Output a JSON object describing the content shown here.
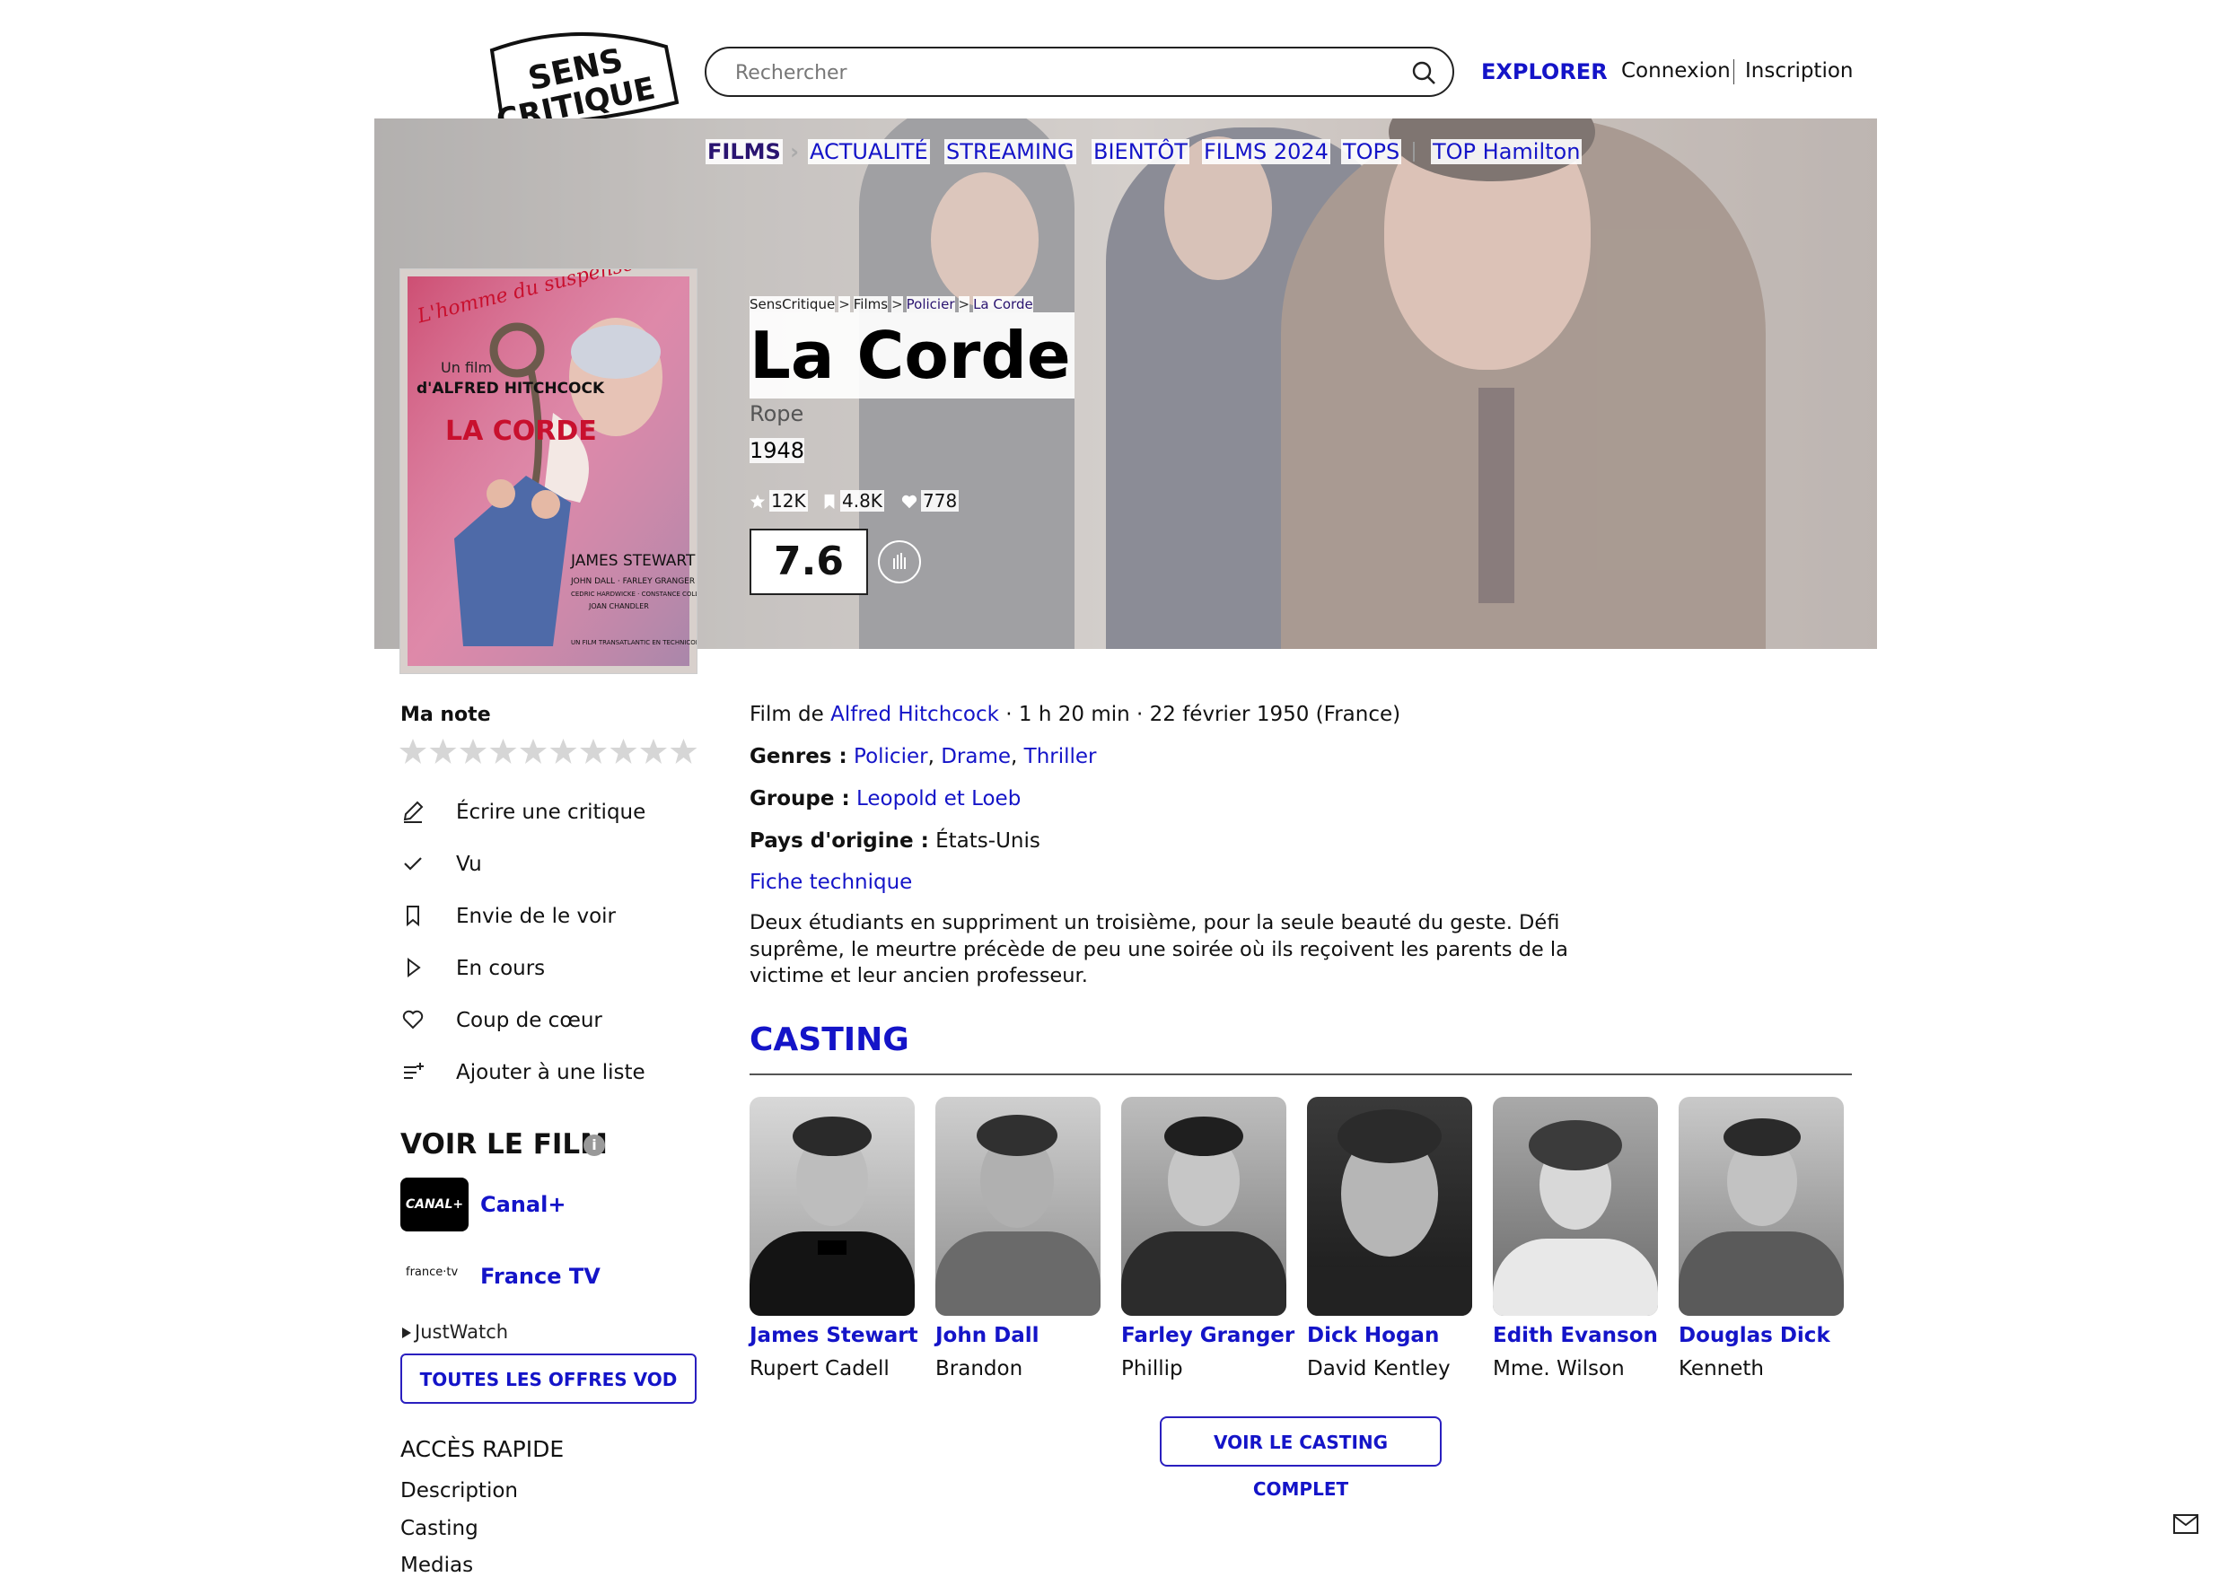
{
  "header": {
    "logo_text": "SENS CRITIQUE",
    "search_placeholder": "Rechercher",
    "explorer": "EXPLORER",
    "connexion": "Connexion",
    "inscription": "Inscription"
  },
  "nav": {
    "films": "FILMS",
    "items": [
      "ACTUALITÉ",
      "STREAMING",
      "BIENTÔT",
      "FILMS 2024",
      "TOPS",
      "TOP Hamilton"
    ]
  },
  "breadcrumb": [
    "SensCritique",
    "Films",
    "Policier",
    "La Corde"
  ],
  "movie": {
    "title": "La Corde",
    "original_title": "Rope",
    "year": "1948",
    "ratings_count": "12K",
    "wishlist_count": "4.8K",
    "favorites_count": "778",
    "score": "7.6",
    "poster_text": {
      "tagline": "L'homme du suspense!",
      "by": "Un film",
      "director": "d'ALFRED HITCHCOCK",
      "title": "LA CORDE",
      "star": "JAMES STEWART",
      "costars": "JOHN DALL · FARLEY GRANGER",
      "costars2": "CEDRIC HARDWICKE · CONSTANCE COLLIER",
      "costars3": "JOAN CHANDLER",
      "format": "UN FILM TRANSATLANTIC EN TECHNICOLOR"
    }
  },
  "sidebar": {
    "ma_note": "Ma note",
    "actions": [
      "Écrire une critique",
      "Vu",
      "Envie de le voir",
      "En cours",
      "Coup de cœur",
      "Ajouter à une liste"
    ],
    "voir_le_film": "VOIR LE FILM",
    "info_icon": "i",
    "providers": [
      {
        "name": "Canal+",
        "logo": "CANAL+"
      },
      {
        "name": "France TV",
        "logo": "france·tv"
      }
    ],
    "justwatch": "JustWatch",
    "vod_button": "TOUTES LES OFFRES VOD",
    "acces_rapide": "ACCÈS RAPIDE",
    "quick_links": [
      "Description",
      "Casting",
      "Medias"
    ]
  },
  "details": {
    "film_de_label": "Film de",
    "director": "Alfred Hitchcock",
    "meta": "· 1 h 20 min · 22 février 1950 (France)",
    "genres_label": "Genres :",
    "genres": [
      "Policier",
      "Drame",
      "Thriller"
    ],
    "groupe_label": "Groupe :",
    "groupe": "Leopold et Loeb",
    "pays_label": "Pays d'origine :",
    "pays": "États-Unis",
    "fiche": "Fiche technique",
    "synopsis": "Deux étudiants en suppriment un troisième, pour la seule beauté du geste. Défi suprême, le meurtre précède de peu une soirée où ils reçoivent les parents de la victime et leur ancien professeur."
  },
  "casting": {
    "heading": "CASTING",
    "actors": [
      {
        "name": "James Stewart",
        "role": "Rupert Cadell"
      },
      {
        "name": "John Dall",
        "role": "Brandon"
      },
      {
        "name": "Farley Granger",
        "role": "Phillip"
      },
      {
        "name": "Dick Hogan",
        "role": "David Kentley"
      },
      {
        "name": "Edith Evanson",
        "role": "Mme. Wilson"
      },
      {
        "name": "Douglas Dick",
        "role": "Kenneth"
      }
    ],
    "full_cast_button": "VOIR LE CASTING COMPLET"
  },
  "colors": {
    "accent_blue": "#1414c8",
    "films_purple": "#2a1470"
  }
}
